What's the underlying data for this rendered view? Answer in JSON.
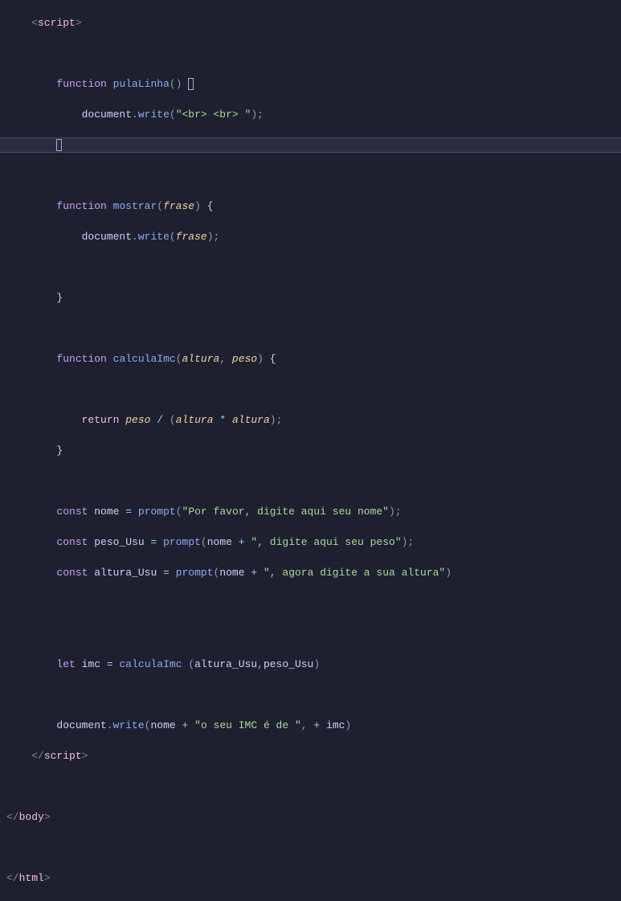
{
  "code": {
    "tag_script": "script",
    "tag_body": "body",
    "tag_html": "html",
    "kw_function": "function",
    "kw_return": "return",
    "kw_const": "const",
    "kw_let": "let",
    "fn_pulaLinha": "pulaLinha",
    "fn_mostrar": "mostrar",
    "fn_calculaImc": "calculaImc",
    "fn_write": "write",
    "fn_prompt": "prompt",
    "obj_document": "document",
    "param_frase": "frase",
    "param_altura": "altura",
    "param_peso": "peso",
    "var_nome": "nome",
    "var_peso_Usu": "peso_Usu",
    "var_altura_Usu": "altura_Usu",
    "var_imc": "imc",
    "str_br": "\"<br> <br> \"",
    "str_prompt_nome": "\"Por favor, digite aqui seu nome\"",
    "str_prompt_peso": "\", digite aqui seu peso\"",
    "str_prompt_altura": "\", agora digite a sua altura\"",
    "str_imc_msg": "\"o seu IMC é de \""
  }
}
